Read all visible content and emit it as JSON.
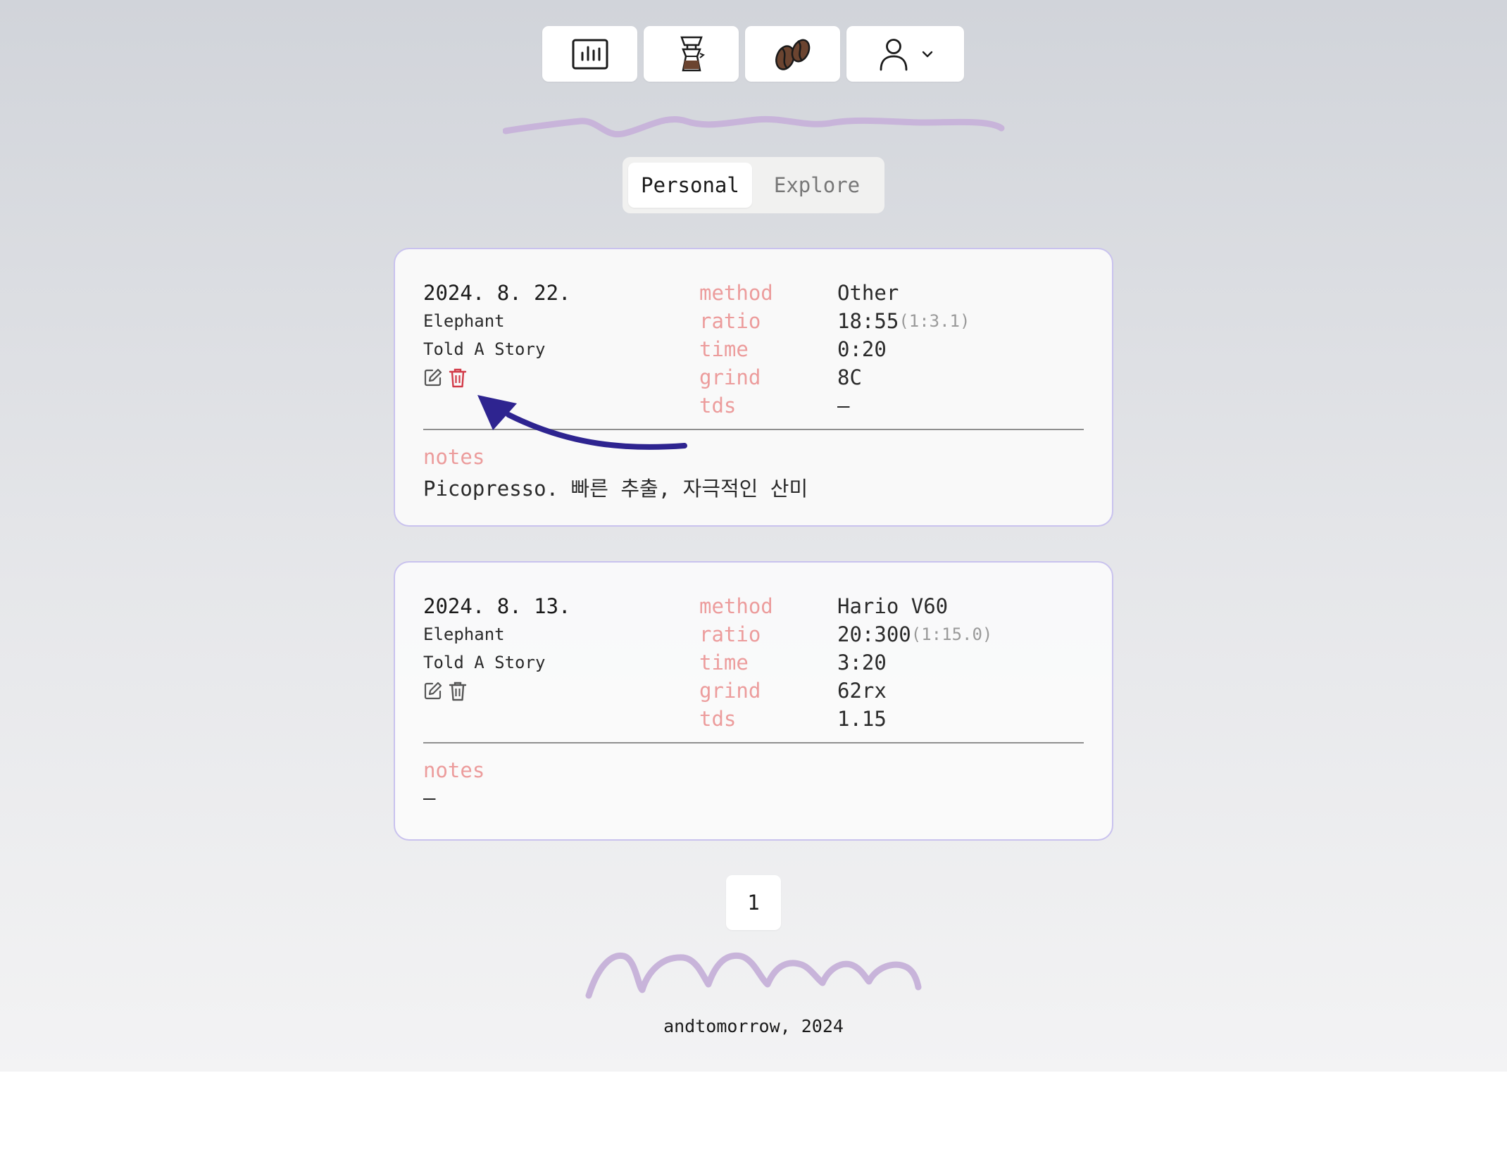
{
  "nav": {
    "items": [
      {
        "icon": "chart-icon"
      },
      {
        "icon": "coffee-dripper-icon"
      },
      {
        "icon": "coffee-beans-icon"
      },
      {
        "icon": "user-icon",
        "dropdown": "chevron-down-icon"
      }
    ]
  },
  "tabs": [
    {
      "label": "Personal",
      "active": true
    },
    {
      "label": "Explore",
      "active": false
    }
  ],
  "field_labels": {
    "method": "method",
    "ratio": "ratio",
    "time": "time",
    "grind": "grind",
    "tds": "tds",
    "notes": "notes"
  },
  "records": [
    {
      "date": "2024. 8. 22.",
      "roaster": "Elephant",
      "bean": "Told A Story",
      "method": "Other",
      "ratio": "18:55",
      "ratio_sub": "(1:3.1)",
      "time": "0:20",
      "grind": "8C",
      "tds": "—",
      "notes": "Picopresso. 빠른 추출, 자극적인 산미",
      "delete_highlighted": true
    },
    {
      "date": "2024. 8. 13.",
      "roaster": "Elephant",
      "bean": "Told A Story",
      "method": "Hario V60",
      "ratio": "20:300",
      "ratio_sub": "(1:15.0)",
      "time": "3:20",
      "grind": "62rx",
      "tds": "1.15",
      "notes": "—",
      "delete_highlighted": false
    }
  ],
  "pagination": {
    "current": "1"
  },
  "footer": {
    "text": "andtomorrow, 2024"
  },
  "colors": {
    "label": "#ec9c9c",
    "card_border": "#c9c2ee",
    "squiggle": "#c8b4da",
    "delete_active": "#d23a48",
    "annotation_arrow": "#2e2490"
  }
}
